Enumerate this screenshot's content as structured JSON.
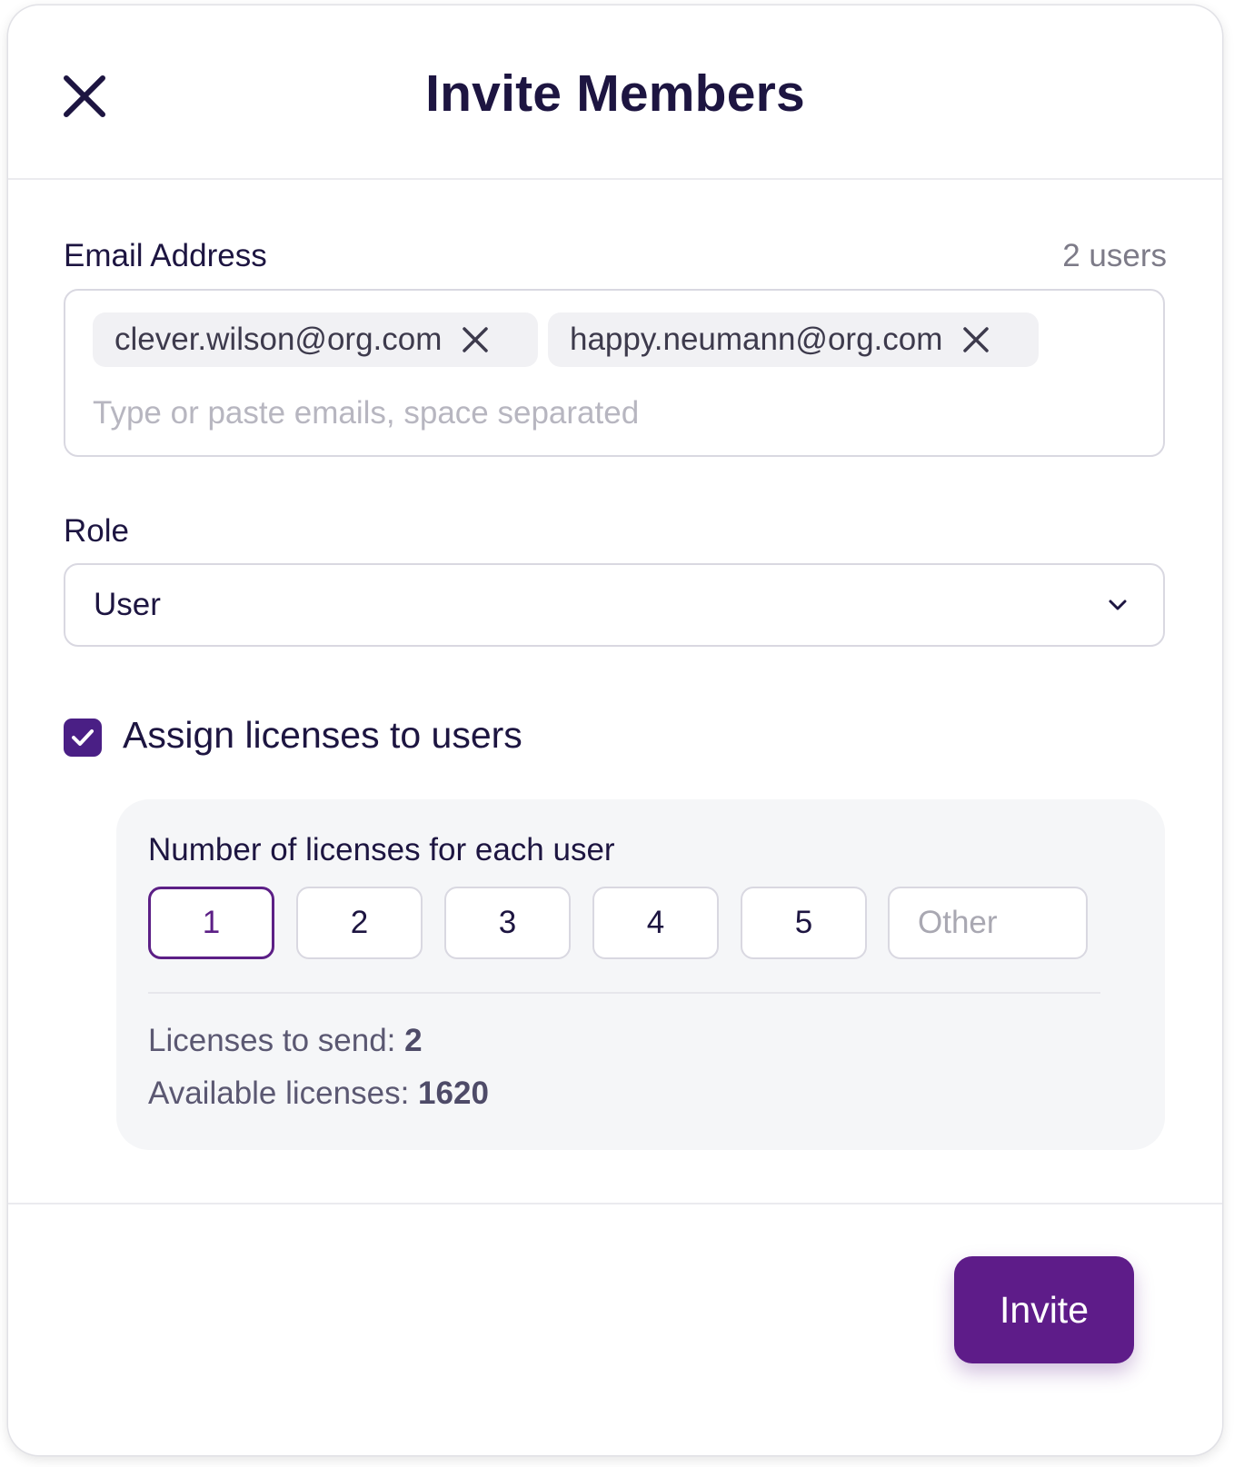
{
  "dialog": {
    "title": "Invite Members",
    "close_icon": "close-icon"
  },
  "email": {
    "label": "Email Address",
    "count": "2 users",
    "chips": [
      "clever.wilson@org.com",
      "happy.neumann@org.com"
    ],
    "placeholder": "Type or paste emails, space separated"
  },
  "role": {
    "label": "Role",
    "value": "User",
    "icon": "chevron-down-icon"
  },
  "licenses": {
    "checkbox_label": "Assign licenses to users",
    "checked": true,
    "per_user_label": "Number of licenses for each user",
    "options": [
      "1",
      "2",
      "3",
      "4",
      "5"
    ],
    "selected": "1",
    "other_placeholder": "Other",
    "to_send_label": "Licenses to send:",
    "to_send_value": "2",
    "available_label": "Available licenses:",
    "available_value": "1620"
  },
  "footer": {
    "invite_label": "Invite"
  },
  "colors": {
    "accent": "#5e1c89",
    "title": "#1d1541",
    "panel_bg": "#f5f6f8"
  }
}
